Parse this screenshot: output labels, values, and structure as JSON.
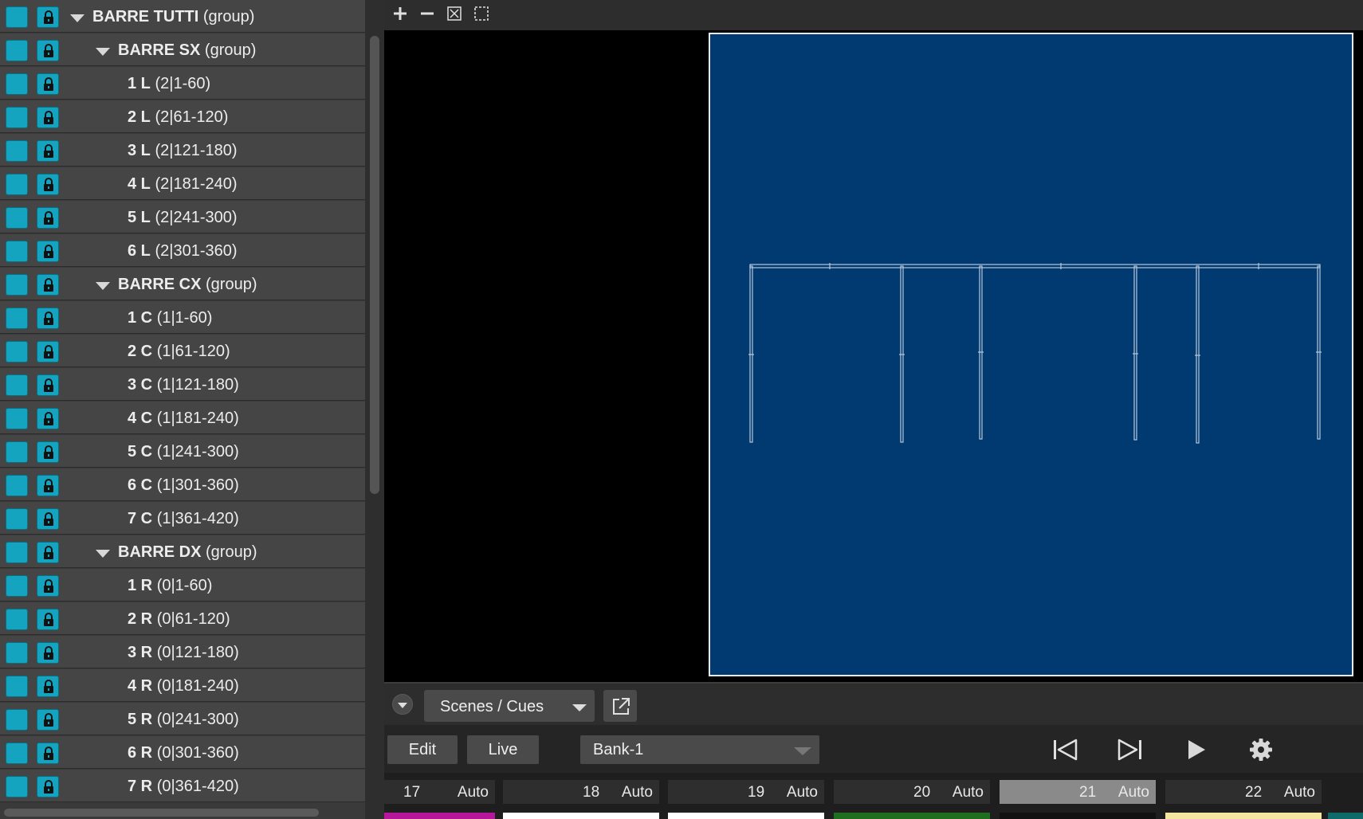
{
  "tree": {
    "rows": [
      {
        "name": "BARRE TUTTI",
        "info": "(group)",
        "level": 0,
        "group": true
      },
      {
        "name": "BARRE SX",
        "info": "(group)",
        "level": 1,
        "group": true
      },
      {
        "name": "1 L",
        "info": "(2|1-60)",
        "level": 2
      },
      {
        "name": "2 L",
        "info": "(2|61-120)",
        "level": 2
      },
      {
        "name": "3 L",
        "info": "(2|121-180)",
        "level": 2
      },
      {
        "name": "4 L",
        "info": "(2|181-240)",
        "level": 2
      },
      {
        "name": "5 L",
        "info": "(2|241-300)",
        "level": 2
      },
      {
        "name": "6 L",
        "info": "(2|301-360)",
        "level": 2
      },
      {
        "name": "BARRE CX",
        "info": "(group)",
        "level": 1,
        "group": true
      },
      {
        "name": "1 C",
        "info": "(1|1-60)",
        "level": 2
      },
      {
        "name": "2 C",
        "info": "(1|61-120)",
        "level": 2
      },
      {
        "name": "3 C",
        "info": "(1|121-180)",
        "level": 2
      },
      {
        "name": "4 C",
        "info": "(1|181-240)",
        "level": 2
      },
      {
        "name": "5 C",
        "info": "(1|241-300)",
        "level": 2
      },
      {
        "name": "6 C",
        "info": "(1|301-360)",
        "level": 2
      },
      {
        "name": "7 C",
        "info": "(1|361-420)",
        "level": 2
      },
      {
        "name": "BARRE DX",
        "info": "(group)",
        "level": 1,
        "group": true
      },
      {
        "name": "1 R",
        "info": "(0|1-60)",
        "level": 2
      },
      {
        "name": "2 R",
        "info": "(0|61-120)",
        "level": 2
      },
      {
        "name": "3 R",
        "info": "(0|121-180)",
        "level": 2
      },
      {
        "name": "4 R",
        "info": "(0|181-240)",
        "level": 2
      },
      {
        "name": "5 R",
        "info": "(0|241-300)",
        "level": 2
      },
      {
        "name": "6 R",
        "info": "(0|301-360)",
        "level": 2
      },
      {
        "name": "7 R",
        "info": "(0|361-420)",
        "level": 2
      }
    ],
    "swatch_color": "#14a4bf"
  },
  "toolbar": {
    "icons": [
      "zoom-in-icon",
      "zoom-out-icon",
      "fit-to-view-icon",
      "selection-frame-icon"
    ]
  },
  "stage": {
    "background": "#003a70"
  },
  "panel": {
    "selector_label": "Scenes / Cues",
    "popout_icon": "popout-icon"
  },
  "controls": {
    "edit_label": "Edit",
    "live_label": "Live",
    "bank_value": "Bank-1",
    "transport_icons": [
      "skip-to-start-icon",
      "skip-next-icon",
      "play-icon",
      "settings-gear-icon"
    ]
  },
  "cues": [
    {
      "number": "17",
      "mode": "Auto",
      "color": "#b5169a",
      "active": false
    },
    {
      "number": "18",
      "mode": "Auto",
      "color": "#ffffff",
      "active": false
    },
    {
      "number": "19",
      "mode": "Auto",
      "color": "#ffffff",
      "active": false
    },
    {
      "number": "20",
      "mode": "Auto",
      "color": "#1f6d1f",
      "active": false
    },
    {
      "number": "21",
      "mode": "Auto",
      "color": "#111111",
      "active": true
    },
    {
      "number": "22",
      "mode": "Auto",
      "color": "#f4e6a0",
      "active": false
    }
  ]
}
